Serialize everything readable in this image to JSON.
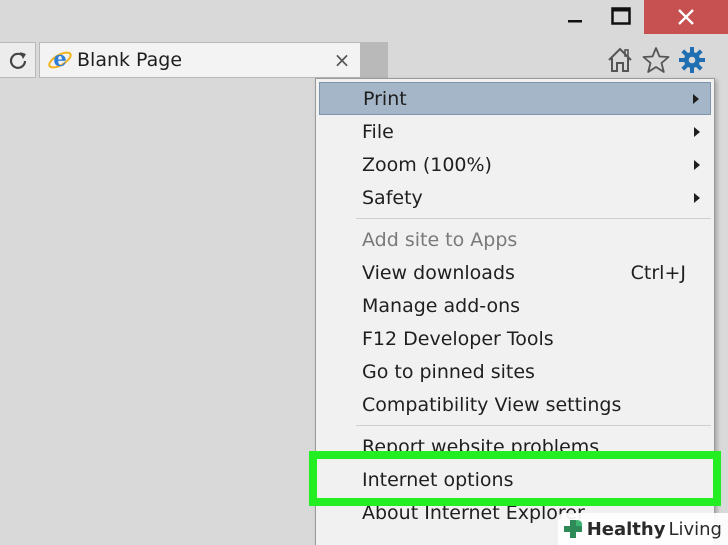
{
  "window": {
    "controls": {
      "minimize_icon": "minimize-icon",
      "maximize_icon": "maximize-icon",
      "close_icon": "close-icon",
      "close_color": "#c75050"
    }
  },
  "toolbar": {
    "refresh_icon": "refresh-icon",
    "tab": {
      "title": "Blank Page",
      "close_glyph": "×",
      "icon": "internet-explorer-icon"
    },
    "icons": [
      "home-icon",
      "favorites-star-icon",
      "tools-gear-icon"
    ],
    "gear_color": "#1f6fb2"
  },
  "menu": {
    "items": [
      {
        "label": "Print",
        "submenu": true,
        "highlighted": true
      },
      {
        "label": "File",
        "submenu": true
      },
      {
        "label": "Zoom (100%)",
        "submenu": true
      },
      {
        "label": "Safety",
        "submenu": true
      },
      {
        "label": "Add site to Apps",
        "disabled": true
      },
      {
        "label": "View downloads",
        "shortcut": "Ctrl+J"
      },
      {
        "label": "Manage add-ons"
      },
      {
        "label": "F12 Developer Tools"
      },
      {
        "label": "Go to pinned sites"
      },
      {
        "label": "Compatibility View settings"
      },
      {
        "label": "Report website problems"
      },
      {
        "label": "Internet options"
      },
      {
        "label": "About Internet Explorer"
      }
    ],
    "highlight_color": "#a5b6c8"
  },
  "annotation": {
    "green_box_color": "#22ee22"
  },
  "watermark": {
    "bold_text": "Healthy",
    "text": "Living",
    "icon": "plus-leaf-icon"
  }
}
